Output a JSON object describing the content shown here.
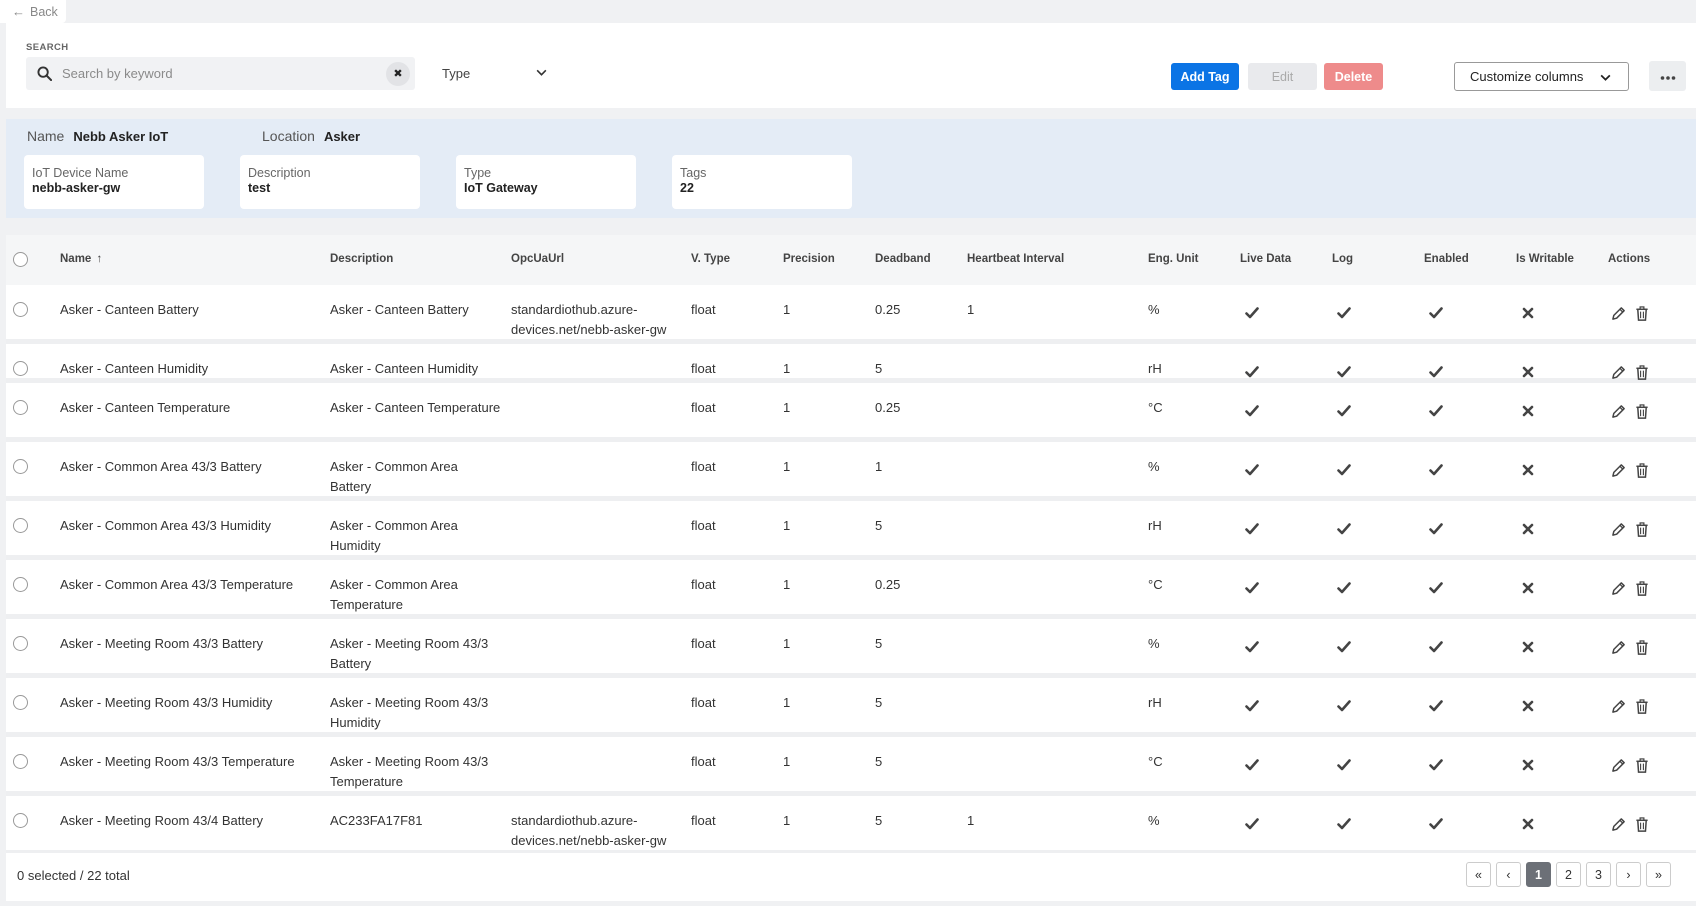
{
  "back": {
    "label": "Back"
  },
  "search": {
    "section_label": "SEARCH",
    "placeholder": "Search by keyword",
    "value": ""
  },
  "type_filter": {
    "label": "Type"
  },
  "toolbar": {
    "add_label": "Add Tag",
    "edit_label": "Edit",
    "delete_label": "Delete",
    "customize_label": "Customize columns"
  },
  "colors": {
    "primary": "#0b74e5",
    "danger": "#ee8b8b",
    "info_bg": "#e4ecf6"
  },
  "device": {
    "name_label": "Name",
    "name_value": "Nebb Asker IoT",
    "location_label": "Location",
    "location_value": "Asker",
    "cards": [
      {
        "label": "IoT Device Name",
        "value": "nebb-asker-gw"
      },
      {
        "label": "Description",
        "value": "test"
      },
      {
        "label": "Type",
        "value": "IoT Gateway"
      },
      {
        "label": "Tags",
        "value": "22"
      }
    ]
  },
  "table": {
    "columns": {
      "name": "Name",
      "description": "Description",
      "opcua": "OpcUaUrl",
      "vtype": "V. Type",
      "precision": "Precision",
      "deadband": "Deadband",
      "heartbeat": "Heartbeat Interval",
      "unit": "Eng. Unit",
      "live": "Live Data",
      "log": "Log",
      "enabled": "Enabled",
      "writable": "Is Writable",
      "actions": "Actions"
    },
    "sort_icon": "arrow-up-icon",
    "rows": [
      {
        "name": "Asker - Canteen Battery",
        "description": "Asker - Canteen Battery",
        "opcua": "standardiothub.azure-devices.net/nebb-asker-gw",
        "vtype": "float",
        "precision": "1",
        "deadband": "0.25",
        "heartbeat": "1",
        "unit": "%",
        "live": true,
        "log": true,
        "enabled": true,
        "writable": false
      },
      {
        "name": "Asker - Canteen Humidity",
        "description": "Asker - Canteen Humidity",
        "opcua": "",
        "vtype": "float",
        "precision": "1",
        "deadband": "5",
        "heartbeat": "",
        "unit": "rH",
        "live": true,
        "log": true,
        "enabled": true,
        "writable": false
      },
      {
        "name": "Asker - Canteen Temperature",
        "description": "Asker - Canteen Temperature",
        "opcua": "",
        "vtype": "float",
        "precision": "1",
        "deadband": "0.25",
        "heartbeat": "",
        "unit": "°C",
        "live": true,
        "log": true,
        "enabled": true,
        "writable": false
      },
      {
        "name": "Asker - Common Area 43/3 Battery",
        "description": "Asker - Common Area Battery",
        "opcua": "",
        "vtype": "float",
        "precision": "1",
        "deadband": "1",
        "heartbeat": "",
        "unit": "%",
        "live": true,
        "log": true,
        "enabled": true,
        "writable": false
      },
      {
        "name": "Asker - Common Area 43/3 Humidity",
        "description": "Asker - Common Area Humidity",
        "opcua": "",
        "vtype": "float",
        "precision": "1",
        "deadband": "5",
        "heartbeat": "",
        "unit": "rH",
        "live": true,
        "log": true,
        "enabled": true,
        "writable": false
      },
      {
        "name": "Asker - Common Area 43/3 Temperature",
        "description": "Asker - Common Area Temperature",
        "opcua": "",
        "vtype": "float",
        "precision": "1",
        "deadband": "0.25",
        "heartbeat": "",
        "unit": "°C",
        "live": true,
        "log": true,
        "enabled": true,
        "writable": false
      },
      {
        "name": "Asker - Meeting Room 43/3 Battery",
        "description": "Asker - Meeting Room 43/3 Battery",
        "opcua": "",
        "vtype": "float",
        "precision": "1",
        "deadband": "5",
        "heartbeat": "",
        "unit": "%",
        "live": true,
        "log": true,
        "enabled": true,
        "writable": false
      },
      {
        "name": "Asker - Meeting Room 43/3 Humidity",
        "description": "Asker - Meeting Room 43/3 Humidity",
        "opcua": "",
        "vtype": "float",
        "precision": "1",
        "deadband": "5",
        "heartbeat": "",
        "unit": "rH",
        "live": true,
        "log": true,
        "enabled": true,
        "writable": false
      },
      {
        "name": "Asker - Meeting Room 43/3 Temperature",
        "description": "Asker - Meeting Room 43/3 Temperature",
        "opcua": "",
        "vtype": "float",
        "precision": "1",
        "deadband": "5",
        "heartbeat": "",
        "unit": "°C",
        "live": true,
        "log": true,
        "enabled": true,
        "writable": false
      },
      {
        "name": "Asker - Meeting Room 43/4 Battery",
        "description": "AC233FA17F81",
        "opcua": "standardiothub.azure-devices.net/nebb-asker-gw",
        "vtype": "float",
        "precision": "1",
        "deadband": "5",
        "heartbeat": "1",
        "unit": "%",
        "live": true,
        "log": true,
        "enabled": true,
        "writable": false
      }
    ]
  },
  "footer": {
    "selection": "0 selected / 22 total",
    "pages": [
      "1",
      "2",
      "3"
    ],
    "current_page": "1",
    "first_label": "«",
    "prev_label": "‹",
    "next_label": "›",
    "last_label": "»"
  }
}
